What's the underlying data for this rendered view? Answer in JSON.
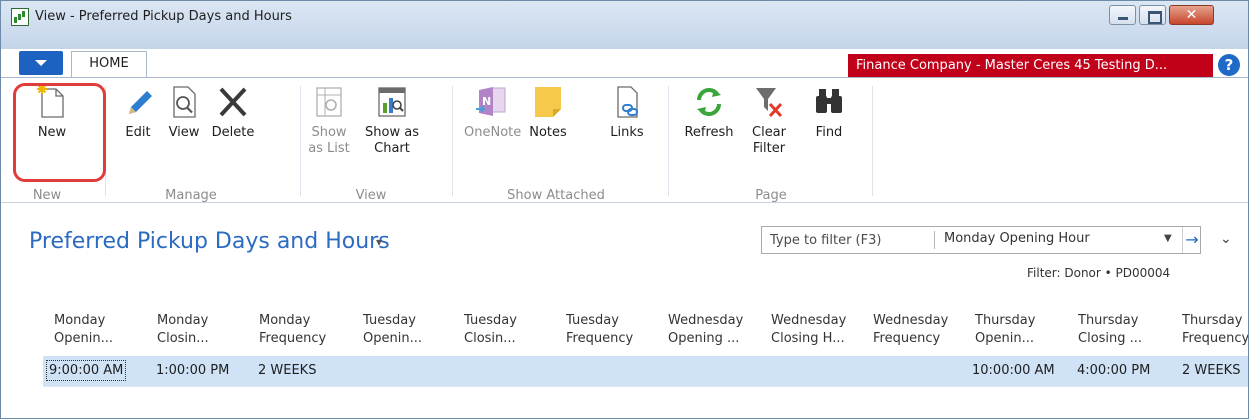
{
  "window": {
    "title": "View - Preferred Pickup Days and Hours",
    "close_glyph": "✕"
  },
  "ribbon_tabs": {
    "home": "HOME",
    "company_banner": "Finance Company - Master Ceres 45 Testing D...",
    "help_glyph": "?"
  },
  "ribbon": {
    "groups": {
      "new": "New",
      "manage": "Manage",
      "view": "View",
      "show_attached": "Show Attached",
      "page": "Page"
    },
    "buttons": {
      "new": "New",
      "edit": "Edit",
      "view": "View",
      "delete": "Delete",
      "show_as_list_1": "Show",
      "show_as_list_2": "as List",
      "show_as_chart_1": "Show as",
      "show_as_chart_2": "Chart",
      "onenote": "OneNote",
      "notes": "Notes",
      "links": "Links",
      "refresh": "Refresh",
      "clear_filter_1": "Clear",
      "clear_filter_2": "Filter",
      "find": "Find"
    }
  },
  "page": {
    "title": "Preferred Pickup Days and Hours",
    "title_caret": "▾",
    "filter": {
      "placeholder": "Type to filter (F3)",
      "field": "Monday Opening Hour",
      "dropdown_glyph": "▼",
      "go_glyph": "→"
    },
    "collapse_glyph": "⌄",
    "active_filter": "Filter: Donor • PD00004"
  },
  "table": {
    "columns": [
      [
        "Monday",
        "Openin..."
      ],
      [
        "Monday",
        "Closin..."
      ],
      [
        "Monday",
        "Frequency"
      ],
      [
        "Tuesday",
        "Openin..."
      ],
      [
        "Tuesday",
        "Closin..."
      ],
      [
        "Tuesday",
        "Frequency"
      ],
      [
        "Wednesday",
        "Opening ..."
      ],
      [
        "Wednesday",
        "Closing H..."
      ],
      [
        "Wednesday",
        "Frequency"
      ],
      [
        "Thursday",
        "Openin..."
      ],
      [
        "Thursday",
        "Closing ..."
      ],
      [
        "Thursday",
        "Frequency"
      ]
    ],
    "row": [
      "9:00:00 AM",
      "1:00:00 PM",
      "2 WEEKS",
      "",
      "",
      "",
      "",
      "",
      "",
      "10:00:00 AM",
      "4:00:00 PM",
      "2 WEEKS"
    ]
  }
}
